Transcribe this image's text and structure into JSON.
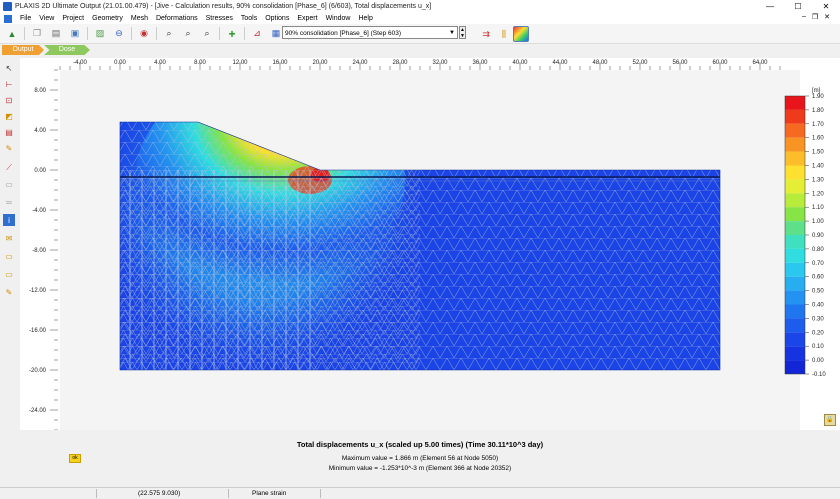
{
  "window": {
    "title": "PLAXIS 2D Ultimate Output (21.01.00.479) - [Jive - Calculation results, 90% consolidation [Phase_6] (6/603), Total displacements u_x]",
    "controls": {
      "minimize": "—",
      "maximize": "☐",
      "close": "✕"
    }
  },
  "menu": {
    "items": [
      "File",
      "View",
      "Project",
      "Geometry",
      "Mesh",
      "Deformations",
      "Stresses",
      "Tools",
      "Options",
      "Expert",
      "Window",
      "Help"
    ],
    "mdi": {
      "minimize": "–",
      "restore": "❐",
      "close": "✕"
    }
  },
  "toolbar": {
    "phase_selector_value": "90% consolidation [Phase_6] (Step 603)"
  },
  "tabs": {
    "output": "Output",
    "dose": "Dose"
  },
  "ruler": {
    "x_ticks": [
      "-4.00",
      "0.00",
      "4.00",
      "8.00",
      "12.00",
      "16.00",
      "20.00",
      "24.00",
      "28.00",
      "32.00",
      "36.00",
      "40.00",
      "44.00",
      "48.00",
      "52.00",
      "56.00",
      "60.00",
      "64.00"
    ],
    "y_ticks": [
      "8.00",
      "4.00",
      "0.00",
      "-4.00",
      "-8.00",
      "-12.00",
      "-16.00",
      "-20.00",
      "-24.00"
    ]
  },
  "legend": {
    "unit": "[m]",
    "labels": [
      "1.90",
      "1.80",
      "1.70",
      "1.60",
      "1.50",
      "1.40",
      "1.30",
      "1.20",
      "1.10",
      "1.00",
      "0.90",
      "0.80",
      "0.70",
      "0.60",
      "0.50",
      "0.40",
      "0.30",
      "0.20",
      "0.10",
      "0.00",
      "-0.10"
    ],
    "colors": [
      "#e8151a",
      "#f03a1c",
      "#f56a20",
      "#f89424",
      "#fbbd2a",
      "#fde030",
      "#e4ee34",
      "#b8ec3a",
      "#86e446",
      "#5ee08a",
      "#3fe0c0",
      "#30dde0",
      "#2ac8ef",
      "#26aef0",
      "#2392f0",
      "#2076ef",
      "#1d5ced",
      "#1a45e8",
      "#1633e2",
      "#1226d8"
    ]
  },
  "colors": {
    "background_blue": "#1a44e6",
    "mesh_line": "#b9c2d8"
  },
  "result_info": {
    "title": "Total displacements u_x (scaled up 5.00 times) (Time 30.11*10^3 day)",
    "max": "Maximum value = 1.866 m (Element 56 at Node 5050)",
    "min": "Minimum value = -1.253*10^-3 m (Element 366 at Node 20352)"
  },
  "status": {
    "coordinates": "(22.575 9.030)",
    "mode": "Plane strain"
  }
}
